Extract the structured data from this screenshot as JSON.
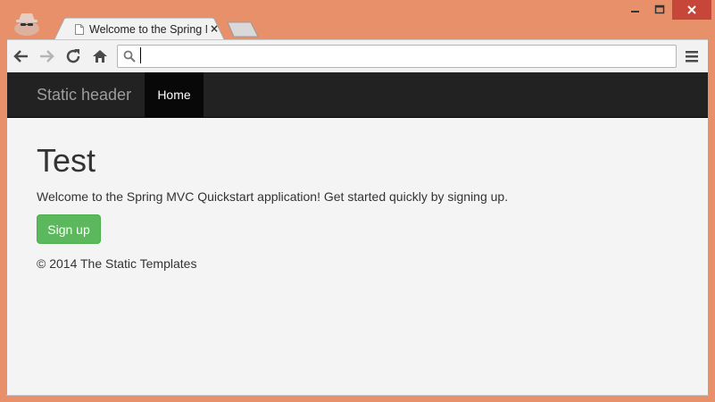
{
  "browser": {
    "tab_title": "Welcome to the Spring MVC Quickstart application",
    "tab_close": "×",
    "address_value": "",
    "address_placeholder": ""
  },
  "navbar": {
    "brand": "Static header",
    "home": "Home"
  },
  "main": {
    "heading": "Test",
    "lead": "Welcome to the Spring MVC Quickstart application! Get started quickly by signing up.",
    "signup_button": "Sign up",
    "footer": "© 2014 The Static Templates"
  },
  "colors": {
    "frame": "#e8906a",
    "navbar": "#222222",
    "button": "#5cb85c",
    "page": "#f4f4f4"
  },
  "icons": [
    "incognito-icon",
    "page-icon",
    "back-arrow-icon",
    "forward-arrow-icon",
    "reload-icon",
    "home-icon",
    "search-icon",
    "menu-icon",
    "minimize-icon",
    "maximize-icon",
    "close-icon"
  ]
}
